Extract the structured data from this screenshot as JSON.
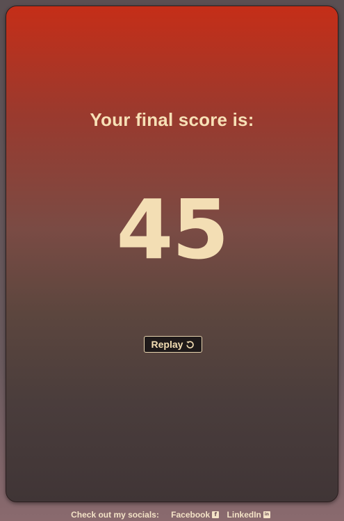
{
  "result": {
    "heading": "Your final score is:",
    "score": "45"
  },
  "actions": {
    "replay_label": "Replay",
    "replay_icon": "replay-icon"
  },
  "footer": {
    "label": "Check out my socials:",
    "links": [
      {
        "label": "Facebook",
        "icon": "facebook-icon",
        "icon_glyph": "f"
      },
      {
        "label": "LinkedIn",
        "icon": "linkedin-icon",
        "icon_glyph": "in"
      }
    ]
  },
  "colors": {
    "accent_text": "#f3deb4",
    "card_top": "#c52e18",
    "card_bottom": "#403536",
    "page_background": "#6a5a5e"
  }
}
